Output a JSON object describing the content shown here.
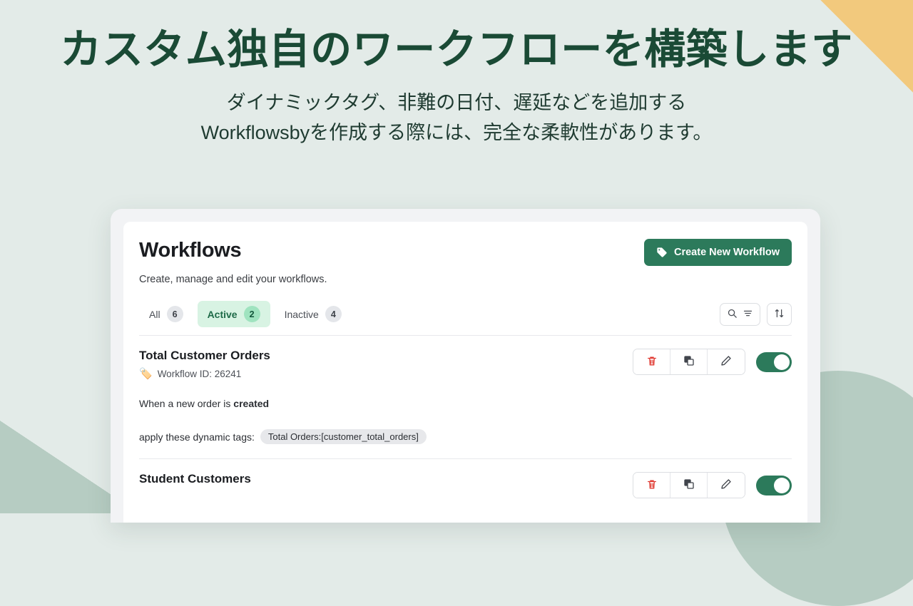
{
  "hero": {
    "title": "カスタム独自のワークフローを構築します",
    "subtitle_line1": "ダイナミックタグ、非難の日付、遅延などを追加する",
    "subtitle_line2": "Workflowsbyを作成する際には、完全な柔軟性があります。",
    "title_color": "#1a4a35",
    "background_color": "#e3ebe8",
    "accent_orange": "#f2c97d",
    "accent_sage": "#b6ccc2"
  },
  "app": {
    "page_title": "Workflows",
    "page_subtitle": "Create, manage and edit your workflows.",
    "create_button": {
      "label": "Create New Workflow",
      "icon": "tag-icon",
      "color": "#2c7a5b"
    },
    "tabs": [
      {
        "label": "All",
        "count": "6",
        "active": false,
        "name": "tab-all"
      },
      {
        "label": "Active",
        "count": "2",
        "active": true,
        "name": "tab-active"
      },
      {
        "label": "Inactive",
        "count": "4",
        "active": false,
        "name": "tab-inactive"
      }
    ],
    "tools": [
      {
        "name": "search-filter-button",
        "icons": "search-icon, filter-icon"
      },
      {
        "name": "sort-button",
        "icons": "sort-arrows-icon"
      }
    ],
    "workflows": [
      {
        "name": "Total Customer Orders",
        "id_label": "Workflow ID: 26241",
        "id_icon": "🏷️",
        "trigger_prefix": "When a new order is ",
        "trigger_event": "created",
        "tags_label": "apply these dynamic tags:",
        "tags": [
          "Total Orders:[customer_total_orders]"
        ],
        "enabled": true,
        "actions": {
          "delete": "delete-icon",
          "duplicate": "duplicate-icon",
          "edit": "edit-pencil-icon",
          "toggle": "enable-toggle"
        }
      },
      {
        "name": "Student Customers",
        "id_label": "",
        "id_icon": "",
        "trigger_prefix": "",
        "trigger_event": "",
        "tags_label": "",
        "tags": [],
        "enabled": true,
        "actions": {
          "delete": "delete-icon",
          "duplicate": "duplicate-icon",
          "edit": "edit-pencil-icon",
          "toggle": "enable-toggle"
        }
      }
    ]
  }
}
